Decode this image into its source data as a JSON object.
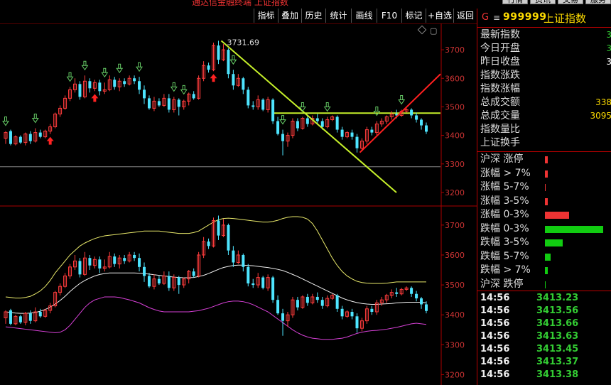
{
  "window": {
    "title": "通达信金融终端 上证指数",
    "right_tabs": [
      "行情",
      "资讯",
      "交易",
      "服务"
    ]
  },
  "toolbar": {
    "buttons": [
      "指标",
      "叠加",
      "历史",
      "统计",
      "画线",
      "F10",
      "标记",
      "+自选",
      "返回"
    ]
  },
  "stock": {
    "marker": "G",
    "menu_icon": "hamburger-icon",
    "code": "999999",
    "name": "上证指数"
  },
  "quote": [
    {
      "label": "最新指数",
      "value": "3",
      "color": "#3c3"
    },
    {
      "label": "今日开盘",
      "value": "3",
      "color": "#3c3"
    },
    {
      "label": "昨日收盘",
      "value": "3",
      "color": "#fff"
    },
    {
      "label": "指数涨跌",
      "value": "",
      "color": "#3c3"
    },
    {
      "label": "指数涨幅",
      "value": "",
      "color": "#3c3"
    },
    {
      "label": "总成交额",
      "value": "338",
      "color": "#fd0"
    },
    {
      "label": "总成交量",
      "value": "3095",
      "color": "#fd0"
    },
    {
      "label": "指数量比",
      "value": "",
      "color": "#fff"
    },
    {
      "label": "上证换手",
      "value": "",
      "color": "#fff"
    }
  ],
  "distribution": [
    {
      "label": "沪深 涨停",
      "fraction": 0.05,
      "color": "#e33"
    },
    {
      "label": "涨幅 > 7%",
      "fraction": 0.05,
      "color": "#e33"
    },
    {
      "label": "涨幅 5-7%",
      "fraction": 0.01,
      "color": "#e33"
    },
    {
      "label": "涨幅 3-5%",
      "fraction": 0.05,
      "color": "#e33"
    },
    {
      "label": "涨幅 0-3%",
      "fraction": 0.4,
      "color": "#e33"
    },
    {
      "label": "跌幅 0-3%",
      "fraction": 0.98,
      "color": "#1c1"
    },
    {
      "label": "跌幅 3-5%",
      "fraction": 0.3,
      "color": "#1c1"
    },
    {
      "label": "跌幅 5-7%",
      "fraction": 0.09,
      "color": "#1c1"
    },
    {
      "label": "跌幅 > 7%",
      "fraction": 0.05,
      "color": "#1c1"
    },
    {
      "label": "沪深 跌停",
      "fraction": 0.01,
      "color": "#1c1"
    }
  ],
  "ticks": [
    {
      "time": "14:56",
      "price": "3413.23"
    },
    {
      "time": "14:56",
      "price": "3413.56"
    },
    {
      "time": "14:56",
      "price": "3413.66"
    },
    {
      "time": "14:56",
      "price": "3413.63"
    },
    {
      "time": "14:56",
      "price": "3413.45"
    },
    {
      "time": "14:56",
      "price": "3413.37"
    },
    {
      "time": "14:56",
      "price": "3413.38"
    }
  ],
  "chart_data": [
    {
      "type": "candlestick",
      "annotation": "3731.69",
      "ylim": [
        3170,
        3745
      ],
      "yticks": [
        3200,
        3300,
        3400,
        3500,
        3600,
        3700
      ],
      "reference_line": 3290,
      "horizontal_line": 3478,
      "candles": [
        [
          3390,
          3410,
          3370,
          3415
        ],
        [
          3415,
          3370,
          3365,
          3420
        ],
        [
          3370,
          3395,
          3365,
          3400
        ],
        [
          3395,
          3375,
          3370,
          3400
        ],
        [
          3375,
          3405,
          3365,
          3410
        ],
        [
          3405,
          3380,
          3370,
          3415
        ],
        [
          3380,
          3410,
          3375,
          3425
        ],
        [
          3410,
          3395,
          3390,
          3420
        ],
        [
          3395,
          3415,
          3390,
          3420
        ],
        [
          3415,
          3430,
          3405,
          3440
        ],
        [
          3430,
          3475,
          3425,
          3480
        ],
        [
          3475,
          3495,
          3465,
          3505
        ],
        [
          3495,
          3530,
          3490,
          3540
        ],
        [
          3530,
          3560,
          3520,
          3570
        ],
        [
          3560,
          3580,
          3550,
          3600
        ],
        [
          3580,
          3535,
          3525,
          3590
        ],
        [
          3535,
          3590,
          3530,
          3610
        ],
        [
          3590,
          3565,
          3550,
          3600
        ],
        [
          3565,
          3585,
          3555,
          3595
        ],
        [
          3585,
          3555,
          3540,
          3595
        ],
        [
          3555,
          3560,
          3545,
          3585
        ],
        [
          3560,
          3595,
          3555,
          3610
        ],
        [
          3595,
          3570,
          3560,
          3605
        ],
        [
          3570,
          3590,
          3555,
          3600
        ],
        [
          3590,
          3580,
          3570,
          3600
        ],
        [
          3580,
          3600,
          3575,
          3610
        ],
        [
          3600,
          3590,
          3580,
          3610
        ],
        [
          3590,
          3560,
          3545,
          3605
        ],
        [
          3560,
          3530,
          3510,
          3575
        ],
        [
          3530,
          3495,
          3490,
          3540
        ],
        [
          3495,
          3520,
          3485,
          3535
        ],
        [
          3520,
          3505,
          3500,
          3530
        ],
        [
          3505,
          3530,
          3500,
          3545
        ],
        [
          3530,
          3490,
          3480,
          3545
        ],
        [
          3490,
          3525,
          3480,
          3535
        ],
        [
          3525,
          3500,
          3470,
          3530
        ],
        [
          3500,
          3520,
          3490,
          3525
        ],
        [
          3520,
          3545,
          3505,
          3550
        ],
        [
          3545,
          3530,
          3525,
          3555
        ],
        [
          3530,
          3600,
          3525,
          3610
        ],
        [
          3600,
          3645,
          3590,
          3660
        ],
        [
          3645,
          3630,
          3620,
          3655
        ],
        [
          3630,
          3715,
          3625,
          3725
        ],
        [
          3715,
          3665,
          3650,
          3731.69
        ],
        [
          3665,
          3700,
          3660,
          3720
        ],
        [
          3700,
          3615,
          3600,
          3705
        ],
        [
          3615,
          3575,
          3560,
          3630
        ],
        [
          3575,
          3600,
          3570,
          3615
        ],
        [
          3600,
          3560,
          3545,
          3605
        ],
        [
          3560,
          3505,
          3495,
          3570
        ],
        [
          3505,
          3500,
          3490,
          3520
        ],
        [
          3500,
          3525,
          3490,
          3540
        ],
        [
          3525,
          3490,
          3485,
          3530
        ],
        [
          3490,
          3525,
          3480,
          3535
        ],
        [
          3525,
          3450,
          3440,
          3530
        ],
        [
          3450,
          3405,
          3400,
          3465
        ],
        [
          3405,
          3380,
          3330,
          3420
        ],
        [
          3380,
          3400,
          3360,
          3410
        ],
        [
          3400,
          3450,
          3390,
          3460
        ],
        [
          3450,
          3425,
          3415,
          3460
        ],
        [
          3425,
          3460,
          3420,
          3465
        ],
        [
          3460,
          3440,
          3430,
          3470
        ],
        [
          3440,
          3460,
          3435,
          3470
        ],
        [
          3460,
          3450,
          3440,
          3475
        ],
        [
          3450,
          3430,
          3420,
          3460
        ],
        [
          3430,
          3455,
          3425,
          3465
        ],
        [
          3455,
          3465,
          3450,
          3470
        ],
        [
          3465,
          3420,
          3410,
          3470
        ],
        [
          3420,
          3395,
          3385,
          3430
        ],
        [
          3395,
          3410,
          3390,
          3415
        ],
        [
          3410,
          3395,
          3385,
          3420
        ],
        [
          3395,
          3355,
          3340,
          3405
        ],
        [
          3355,
          3380,
          3345,
          3390
        ],
        [
          3380,
          3420,
          3370,
          3430
        ],
        [
          3420,
          3410,
          3400,
          3430
        ],
        [
          3410,
          3440,
          3400,
          3450
        ],
        [
          3440,
          3450,
          3430,
          3460
        ],
        [
          3450,
          3465,
          3440,
          3470
        ],
        [
          3465,
          3475,
          3455,
          3485
        ],
        [
          3475,
          3470,
          3460,
          3490
        ],
        [
          3470,
          3485,
          3465,
          3490
        ],
        [
          3485,
          3490,
          3480,
          3495
        ],
        [
          3490,
          3470,
          3460,
          3495
        ],
        [
          3470,
          3455,
          3445,
          3480
        ],
        [
          3455,
          3435,
          3420,
          3460
        ],
        [
          3435,
          3413,
          3405,
          3445
        ]
      ]
    },
    {
      "type": "candlestick-bollinger",
      "ylim": [
        3175,
        3740
      ],
      "yticks": [
        3200,
        3300,
        3400,
        3500,
        3600,
        3700
      ],
      "series": [
        {
          "role": "upper",
          "values": [
            3460,
            3458,
            3456,
            3456,
            3458,
            3462,
            3470,
            3480,
            3495,
            3515,
            3540,
            3560,
            3580,
            3600,
            3615,
            3630,
            3640,
            3648,
            3655,
            3660,
            3664,
            3666,
            3668,
            3670,
            3672,
            3674,
            3676,
            3678,
            3680,
            3680,
            3680,
            3680,
            3678,
            3676,
            3674,
            3672,
            3672,
            3672,
            3675,
            3680,
            3690,
            3700,
            3710,
            3718,
            3722,
            3723,
            3722,
            3720,
            3718,
            3716,
            3714,
            3712,
            3710,
            3710,
            3712,
            3716,
            3722,
            3726,
            3728,
            3728,
            3726,
            3720,
            3705,
            3680,
            3650,
            3620,
            3590,
            3565,
            3545,
            3530,
            3520,
            3512,
            3508,
            3506,
            3505,
            3505,
            3505,
            3506,
            3508,
            3510,
            3510,
            3510,
            3510,
            3510,
            3510,
            3510
          ]
        },
        {
          "role": "middle",
          "values": [
            3410,
            3408,
            3406,
            3405,
            3405,
            3406,
            3408,
            3412,
            3418,
            3426,
            3436,
            3448,
            3462,
            3478,
            3492,
            3505,
            3515,
            3523,
            3530,
            3535,
            3538,
            3540,
            3540,
            3540,
            3540,
            3540,
            3540,
            3539,
            3538,
            3536,
            3534,
            3532,
            3530,
            3528,
            3526,
            3525,
            3524,
            3524,
            3525,
            3528,
            3532,
            3538,
            3545,
            3552,
            3558,
            3562,
            3565,
            3566,
            3566,
            3565,
            3564,
            3562,
            3560,
            3558,
            3555,
            3552,
            3548,
            3542,
            3535,
            3528,
            3520,
            3512,
            3504,
            3496,
            3488,
            3480,
            3472,
            3464,
            3456,
            3450,
            3445,
            3441,
            3438,
            3436,
            3435,
            3435,
            3436,
            3437,
            3438,
            3440,
            3441,
            3442,
            3442,
            3442,
            3442,
            3440
          ]
        },
        {
          "role": "lower",
          "values": [
            3360,
            3358,
            3356,
            3354,
            3352,
            3350,
            3348,
            3346,
            3344,
            3342,
            3340,
            3342,
            3350,
            3365,
            3385,
            3405,
            3425,
            3440,
            3450,
            3455,
            3460,
            3460,
            3460,
            3458,
            3454,
            3450,
            3445,
            3440,
            3432,
            3424,
            3418,
            3413,
            3410,
            3410,
            3410,
            3410,
            3410,
            3410,
            3412,
            3414,
            3418,
            3422,
            3428,
            3434,
            3440,
            3444,
            3446,
            3446,
            3444,
            3440,
            3434,
            3426,
            3418,
            3410,
            3398,
            3386,
            3374,
            3362,
            3350,
            3340,
            3332,
            3326,
            3322,
            3320,
            3318,
            3318,
            3318,
            3320,
            3322,
            3326,
            3332,
            3338,
            3342,
            3345,
            3347,
            3348,
            3350,
            3352,
            3355,
            3358,
            3362,
            3366,
            3370,
            3372,
            3370,
            3368
          ]
        }
      ]
    }
  ]
}
